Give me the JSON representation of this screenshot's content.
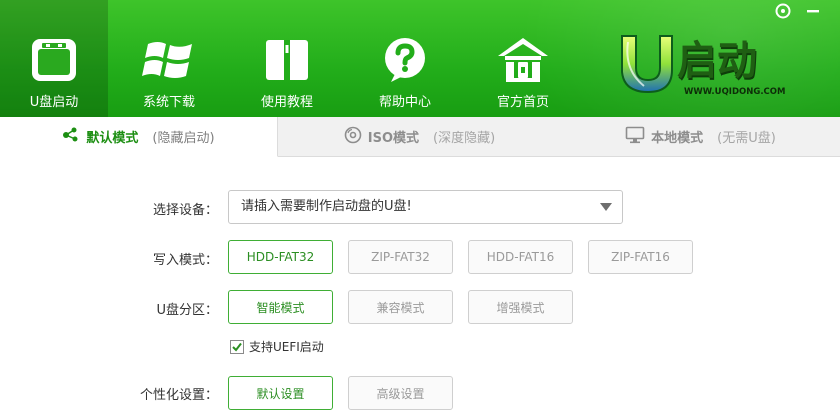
{
  "window_controls": {
    "help_icon": "help-circle-icon",
    "minimize_icon": "minimize-icon"
  },
  "nav": {
    "items": [
      {
        "label": "U盘启动",
        "icon": "usb-drive-icon",
        "active": true
      },
      {
        "label": "系统下载",
        "icon": "windows-logo-icon",
        "active": false
      },
      {
        "label": "使用教程",
        "icon": "book-icon",
        "active": false
      },
      {
        "label": "帮助中心",
        "icon": "question-bubble-icon",
        "active": false
      },
      {
        "label": "官方首页",
        "icon": "home-icon",
        "active": false
      }
    ]
  },
  "logo": {
    "brand_text": "启动",
    "url_text": "WWW.UQIDONG.COM"
  },
  "tabs": [
    {
      "main": "默认模式",
      "sub": "(隐藏启动)",
      "icon": "share-nodes-icon",
      "active": true
    },
    {
      "main": "ISO模式",
      "sub": "(深度隐藏)",
      "icon": "disc-icon",
      "active": false
    },
    {
      "main": "本地模式",
      "sub": "(无需U盘)",
      "icon": "monitor-icon",
      "active": false
    }
  ],
  "form": {
    "device_label": "选择设备：",
    "device_value": "请插入需要制作启动盘的U盘!",
    "write_mode_label": "写入模式：",
    "write_modes": [
      "HDD-FAT32",
      "ZIP-FAT32",
      "HDD-FAT16",
      "ZIP-FAT16"
    ],
    "write_mode_selected": "HDD-FAT32",
    "partition_label": "U盘分区：",
    "partitions": [
      "智能模式",
      "兼容模式",
      "增强模式"
    ],
    "partition_selected": "智能模式",
    "uefi_label": "支持UEFI启动",
    "uefi_checked": true,
    "personalize_label": "个性化设置：",
    "personalize_options": [
      "默认设置",
      "高级设置"
    ],
    "personalize_selected": "默认设置"
  },
  "colors": {
    "header_green": "#22ad1a",
    "accent_green": "#1d8f13",
    "selected_border": "#3fae35"
  }
}
